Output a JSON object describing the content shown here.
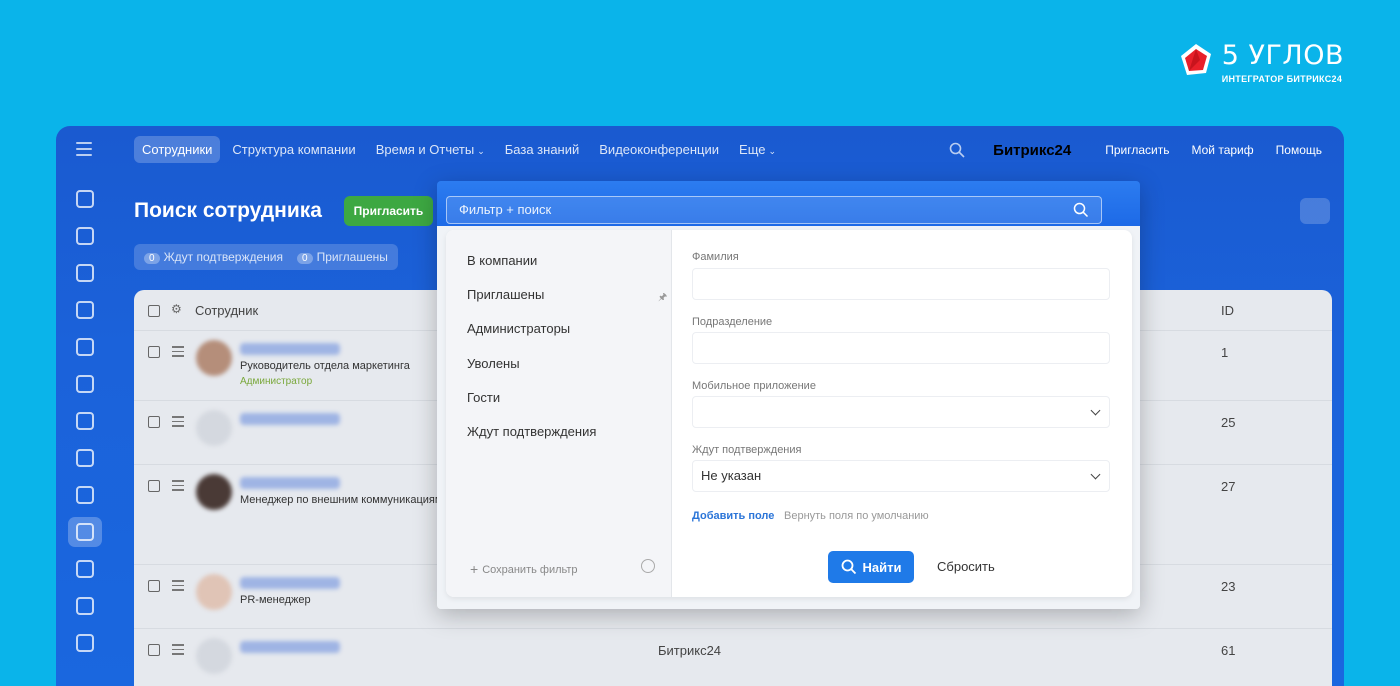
{
  "brand": {
    "name": "5 УГЛОВ",
    "tagline": "ИНТЕГРАТОР БИТРИКС24",
    "logo_color": "#e8202a"
  },
  "topbar": {
    "tabs": [
      {
        "label": "Сотрудники",
        "active": true
      },
      {
        "label": "Структура компании"
      },
      {
        "label": "Время и Отчеты",
        "dropdown": true
      },
      {
        "label": "База знаний"
      },
      {
        "label": "Видеоконференции"
      },
      {
        "label": "Еще",
        "dropdown": true
      }
    ],
    "product": "Битрикс24",
    "invite": "Пригласить",
    "plan": "Мой тариф",
    "help": "Помощь"
  },
  "page": {
    "title": "Поиск сотрудника",
    "invite_button": "Пригласить",
    "counters": [
      {
        "count": "0",
        "label": "Ждут подтверждения"
      },
      {
        "count": "0",
        "label": "Приглашены"
      }
    ]
  },
  "table": {
    "header": {
      "employee": "Сотрудник",
      "id": "ID"
    },
    "rows": [
      {
        "role": "Руководитель отдела маркетинга",
        "badge": "Администратор",
        "id": "1",
        "dept": ""
      },
      {
        "role": "",
        "badge": "",
        "id": "25",
        "dept": ""
      },
      {
        "role": "Менеджер по внешним коммуникациям",
        "badge": "",
        "id": "27",
        "dept": ""
      },
      {
        "role": "PR-менеджер",
        "badge": "",
        "id": "23",
        "dept": ""
      },
      {
        "role": "",
        "badge": "",
        "id": "61",
        "dept": "Битрикс24"
      }
    ]
  },
  "filter": {
    "search_placeholder": "Фильтр + поиск",
    "presets": [
      "В компании",
      "Приглашены",
      "Администраторы",
      "Уволены",
      "Гости",
      "Ждут подтверждения"
    ],
    "save_filter": "Сохранить фильтр",
    "fields": [
      {
        "label": "Фамилия",
        "value": "",
        "type": "text"
      },
      {
        "label": "Подразделение",
        "value": "",
        "type": "text"
      },
      {
        "label": "Мобильное приложение",
        "value": "",
        "type": "select"
      },
      {
        "label": "Ждут подтверждения",
        "value": "Не указан",
        "type": "select"
      }
    ],
    "add_field": "Добавить поле",
    "restore_defaults": "Вернуть поля по умолчанию",
    "find_button": "Найти",
    "reset_button": "Сбросить",
    "accent_color": "#1f7ae8"
  }
}
